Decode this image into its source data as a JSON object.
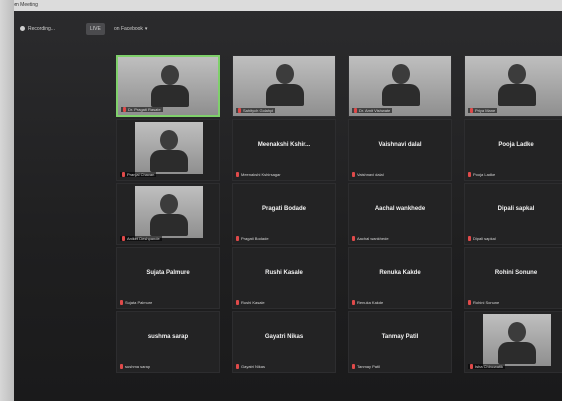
{
  "window": {
    "title": "Zoom Meeting"
  },
  "toolbar": {
    "recording_label": "Recording...",
    "live_label": "LIVE",
    "live_on_label": "on Facebook"
  },
  "participants": [
    {
      "label": "Dr. Pragati Rasate",
      "center_name": "",
      "has_video": true,
      "active": true
    },
    {
      "label": "Sahitych Golahpi",
      "center_name": "",
      "has_video": true,
      "active": false
    },
    {
      "label": "Dr. Amit Vishwate",
      "center_name": "",
      "has_video": true,
      "active": false
    },
    {
      "label": "Priya Mane",
      "center_name": "",
      "has_video": true,
      "active": false
    },
    {
      "label": "Pranjal Chavan",
      "center_name": "",
      "has_video": true,
      "active": false
    },
    {
      "label": "Meenakshi Kshirsagar",
      "center_name": "Meenakshi Kshir...",
      "has_video": false,
      "active": false
    },
    {
      "label": "Vaishnavi dalal",
      "center_name": "Vaishnavi dalal",
      "has_video": false,
      "active": false
    },
    {
      "label": "Pooja Ladke",
      "center_name": "Pooja Ladke",
      "has_video": false,
      "active": false
    },
    {
      "label": "Aniket Deshpande",
      "center_name": "",
      "has_video": true,
      "active": false
    },
    {
      "label": "Pragati Bodade",
      "center_name": "Pragati Bodade",
      "has_video": false,
      "active": false
    },
    {
      "label": "Aachal wankhede",
      "center_name": "Aachal wankhede",
      "has_video": false,
      "active": false
    },
    {
      "label": "Dipali sapkal",
      "center_name": "Dipali sapkal",
      "has_video": false,
      "active": false
    },
    {
      "label": "Sujata Palmure",
      "center_name": "Sujata Palmure",
      "has_video": false,
      "active": false
    },
    {
      "label": "Rushi Kasale",
      "center_name": "Rushi Kasale",
      "has_video": false,
      "active": false
    },
    {
      "label": "Renuka Kakde",
      "center_name": "Renuka Kakde",
      "has_video": false,
      "active": false
    },
    {
      "label": "Rohini Sonune",
      "center_name": "Rohini Sonune",
      "has_video": false,
      "active": false
    },
    {
      "label": "sushma sarap",
      "center_name": "sushma sarap",
      "has_video": false,
      "active": false
    },
    {
      "label": "Gayatri Nikas",
      "center_name": "Gayatri Nikas",
      "has_video": false,
      "active": false
    },
    {
      "label": "Tanmay Patil",
      "center_name": "Tanmay Patil",
      "has_video": false,
      "active": false
    },
    {
      "label": "Isha Chincwatik",
      "center_name": "",
      "has_video": true,
      "active": false
    }
  ]
}
